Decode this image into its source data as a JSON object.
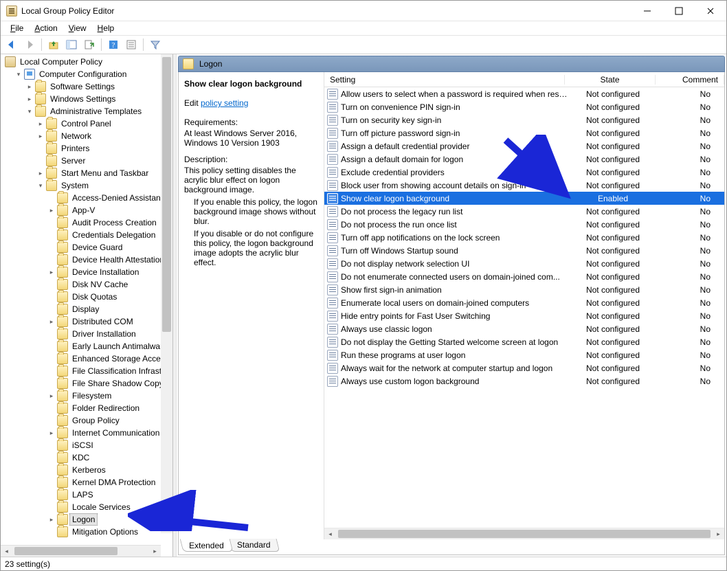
{
  "window": {
    "title": "Local Group Policy Editor"
  },
  "menus": [
    "File",
    "Action",
    "View",
    "Help"
  ],
  "tree": {
    "root": "Local Computer Policy",
    "compConfig": "Computer Configuration",
    "adminTemplates": "Administrative Templates",
    "l3": {
      "softwareSettings": "Software Settings",
      "windowsSettings": "Windows Settings",
      "controlPanel": "Control Panel",
      "network": "Network",
      "printers": "Printers",
      "server": "Server",
      "startMenu": "Start Menu and Taskbar",
      "system": "System"
    },
    "sysChildren": [
      "Access-Denied Assistance",
      "App-V",
      "Audit Process Creation",
      "Credentials Delegation",
      "Device Guard",
      "Device Health Attestation",
      "Device Installation",
      "Disk NV Cache",
      "Disk Quotas",
      "Display",
      "Distributed COM",
      "Driver Installation",
      "Early Launch Antimalware",
      "Enhanced Storage Access",
      "File Classification Infrastructure",
      "File Share Shadow Copy Provider",
      "Filesystem",
      "Folder Redirection",
      "Group Policy",
      "Internet Communication Management",
      "iSCSI",
      "KDC",
      "Kerberos",
      "Kernel DMA Protection",
      "LAPS",
      "Locale Services",
      "Logon",
      "Mitigation Options"
    ],
    "selected": "Logon"
  },
  "rightHeader": "Logon",
  "policy": {
    "name": "Show clear logon background",
    "editPrefix": "Edit ",
    "editLink": "policy setting ",
    "reqTitle": "Requirements:",
    "req1": "At least Windows Server 2016,",
    "req2": "Windows 10 Version 1903",
    "descTitle": "Description:",
    "desc1": "This policy setting disables the acrylic blur effect on logon background image.",
    "desc2a": "If you enable this policy, the logon background image shows without blur.",
    "desc2b": "If you disable or do not configure this policy, the logon background image adopts the acrylic blur effect."
  },
  "columns": {
    "setting": "Setting",
    "state": "State",
    "comment": "Comment"
  },
  "rows": [
    {
      "setting": "Allow users to select when a password is required when resu...",
      "state": "Not configured",
      "comment": "No"
    },
    {
      "setting": "Turn on convenience PIN sign-in",
      "state": "Not configured",
      "comment": "No"
    },
    {
      "setting": "Turn on security key sign-in",
      "state": "Not configured",
      "comment": "No"
    },
    {
      "setting": "Turn off picture password sign-in",
      "state": "Not configured",
      "comment": "No"
    },
    {
      "setting": "Assign a default credential provider",
      "state": "Not configured",
      "comment": "No"
    },
    {
      "setting": "Assign a default domain for logon",
      "state": "Not configured",
      "comment": "No"
    },
    {
      "setting": "Exclude credential providers",
      "state": "Not configured",
      "comment": "No"
    },
    {
      "setting": "Block user from showing account details on sign-in",
      "state": "Not configured",
      "comment": "No"
    },
    {
      "setting": "Show clear logon background",
      "state": "Enabled",
      "comment": "No",
      "selected": true
    },
    {
      "setting": "Do not process the legacy run list",
      "state": "Not configured",
      "comment": "No"
    },
    {
      "setting": "Do not process the run once list",
      "state": "Not configured",
      "comment": "No"
    },
    {
      "setting": "Turn off app notifications on the lock screen",
      "state": "Not configured",
      "comment": "No"
    },
    {
      "setting": "Turn off Windows Startup sound",
      "state": "Not configured",
      "comment": "No"
    },
    {
      "setting": "Do not display network selection UI",
      "state": "Not configured",
      "comment": "No"
    },
    {
      "setting": "Do not enumerate connected users on domain-joined com...",
      "state": "Not configured",
      "comment": "No"
    },
    {
      "setting": "Show first sign-in animation",
      "state": "Not configured",
      "comment": "No"
    },
    {
      "setting": "Enumerate local users on domain-joined computers",
      "state": "Not configured",
      "comment": "No"
    },
    {
      "setting": "Hide entry points for Fast User Switching",
      "state": "Not configured",
      "comment": "No"
    },
    {
      "setting": "Always use classic logon",
      "state": "Not configured",
      "comment": "No"
    },
    {
      "setting": "Do not display the Getting Started welcome screen at logon",
      "state": "Not configured",
      "comment": "No"
    },
    {
      "setting": "Run these programs at user logon",
      "state": "Not configured",
      "comment": "No"
    },
    {
      "setting": "Always wait for the network at computer startup and logon",
      "state": "Not configured",
      "comment": "No"
    },
    {
      "setting": "Always use custom logon background",
      "state": "Not configured",
      "comment": "No"
    }
  ],
  "tabs": {
    "extended": "Extended",
    "standard": "Standard"
  },
  "status": "23 setting(s)"
}
